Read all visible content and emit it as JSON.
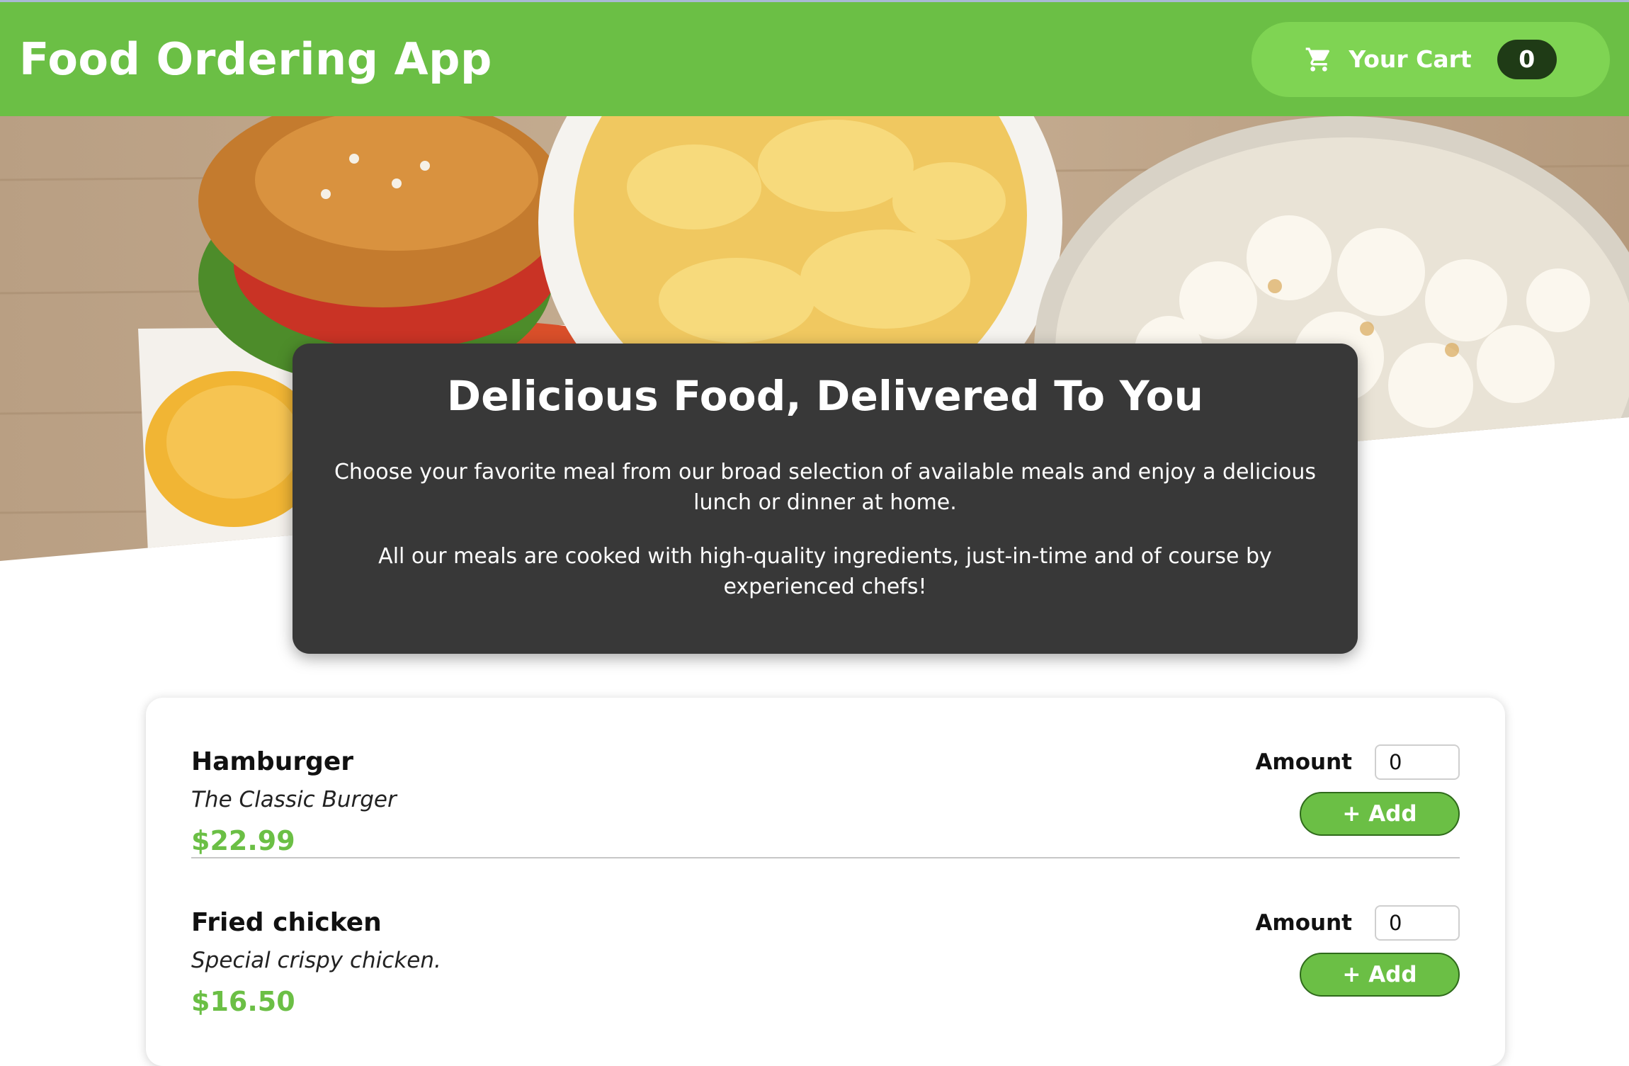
{
  "header": {
    "title": "Food Ordering App",
    "cart": {
      "label": "Your Cart",
      "count": "0",
      "icon": "cart-icon"
    }
  },
  "summary": {
    "heading": "Delicious Food, Delivered To You",
    "paragraphs": [
      "Choose your favorite meal from our broad selection of available meals and enjoy a delicious lunch or dinner at home.",
      "All our meals are cooked with high-quality ingredients, just-in-time and of course by experienced chefs!"
    ]
  },
  "meals": [
    {
      "name": "Hamburger",
      "description": "The Classic Burger",
      "price": "$22.99",
      "amount_label": "Amount",
      "amount_value": "0",
      "add_label": "+ Add"
    },
    {
      "name": "Fried chicken",
      "description": "Special crispy chicken.",
      "price": "$16.50",
      "amount_label": "Amount",
      "amount_value": "0",
      "add_label": "+ Add"
    }
  ],
  "colors": {
    "brand": "#6bbf45",
    "cart_button": "#7fd453",
    "badge": "#1f3b16",
    "card": "#383838"
  }
}
